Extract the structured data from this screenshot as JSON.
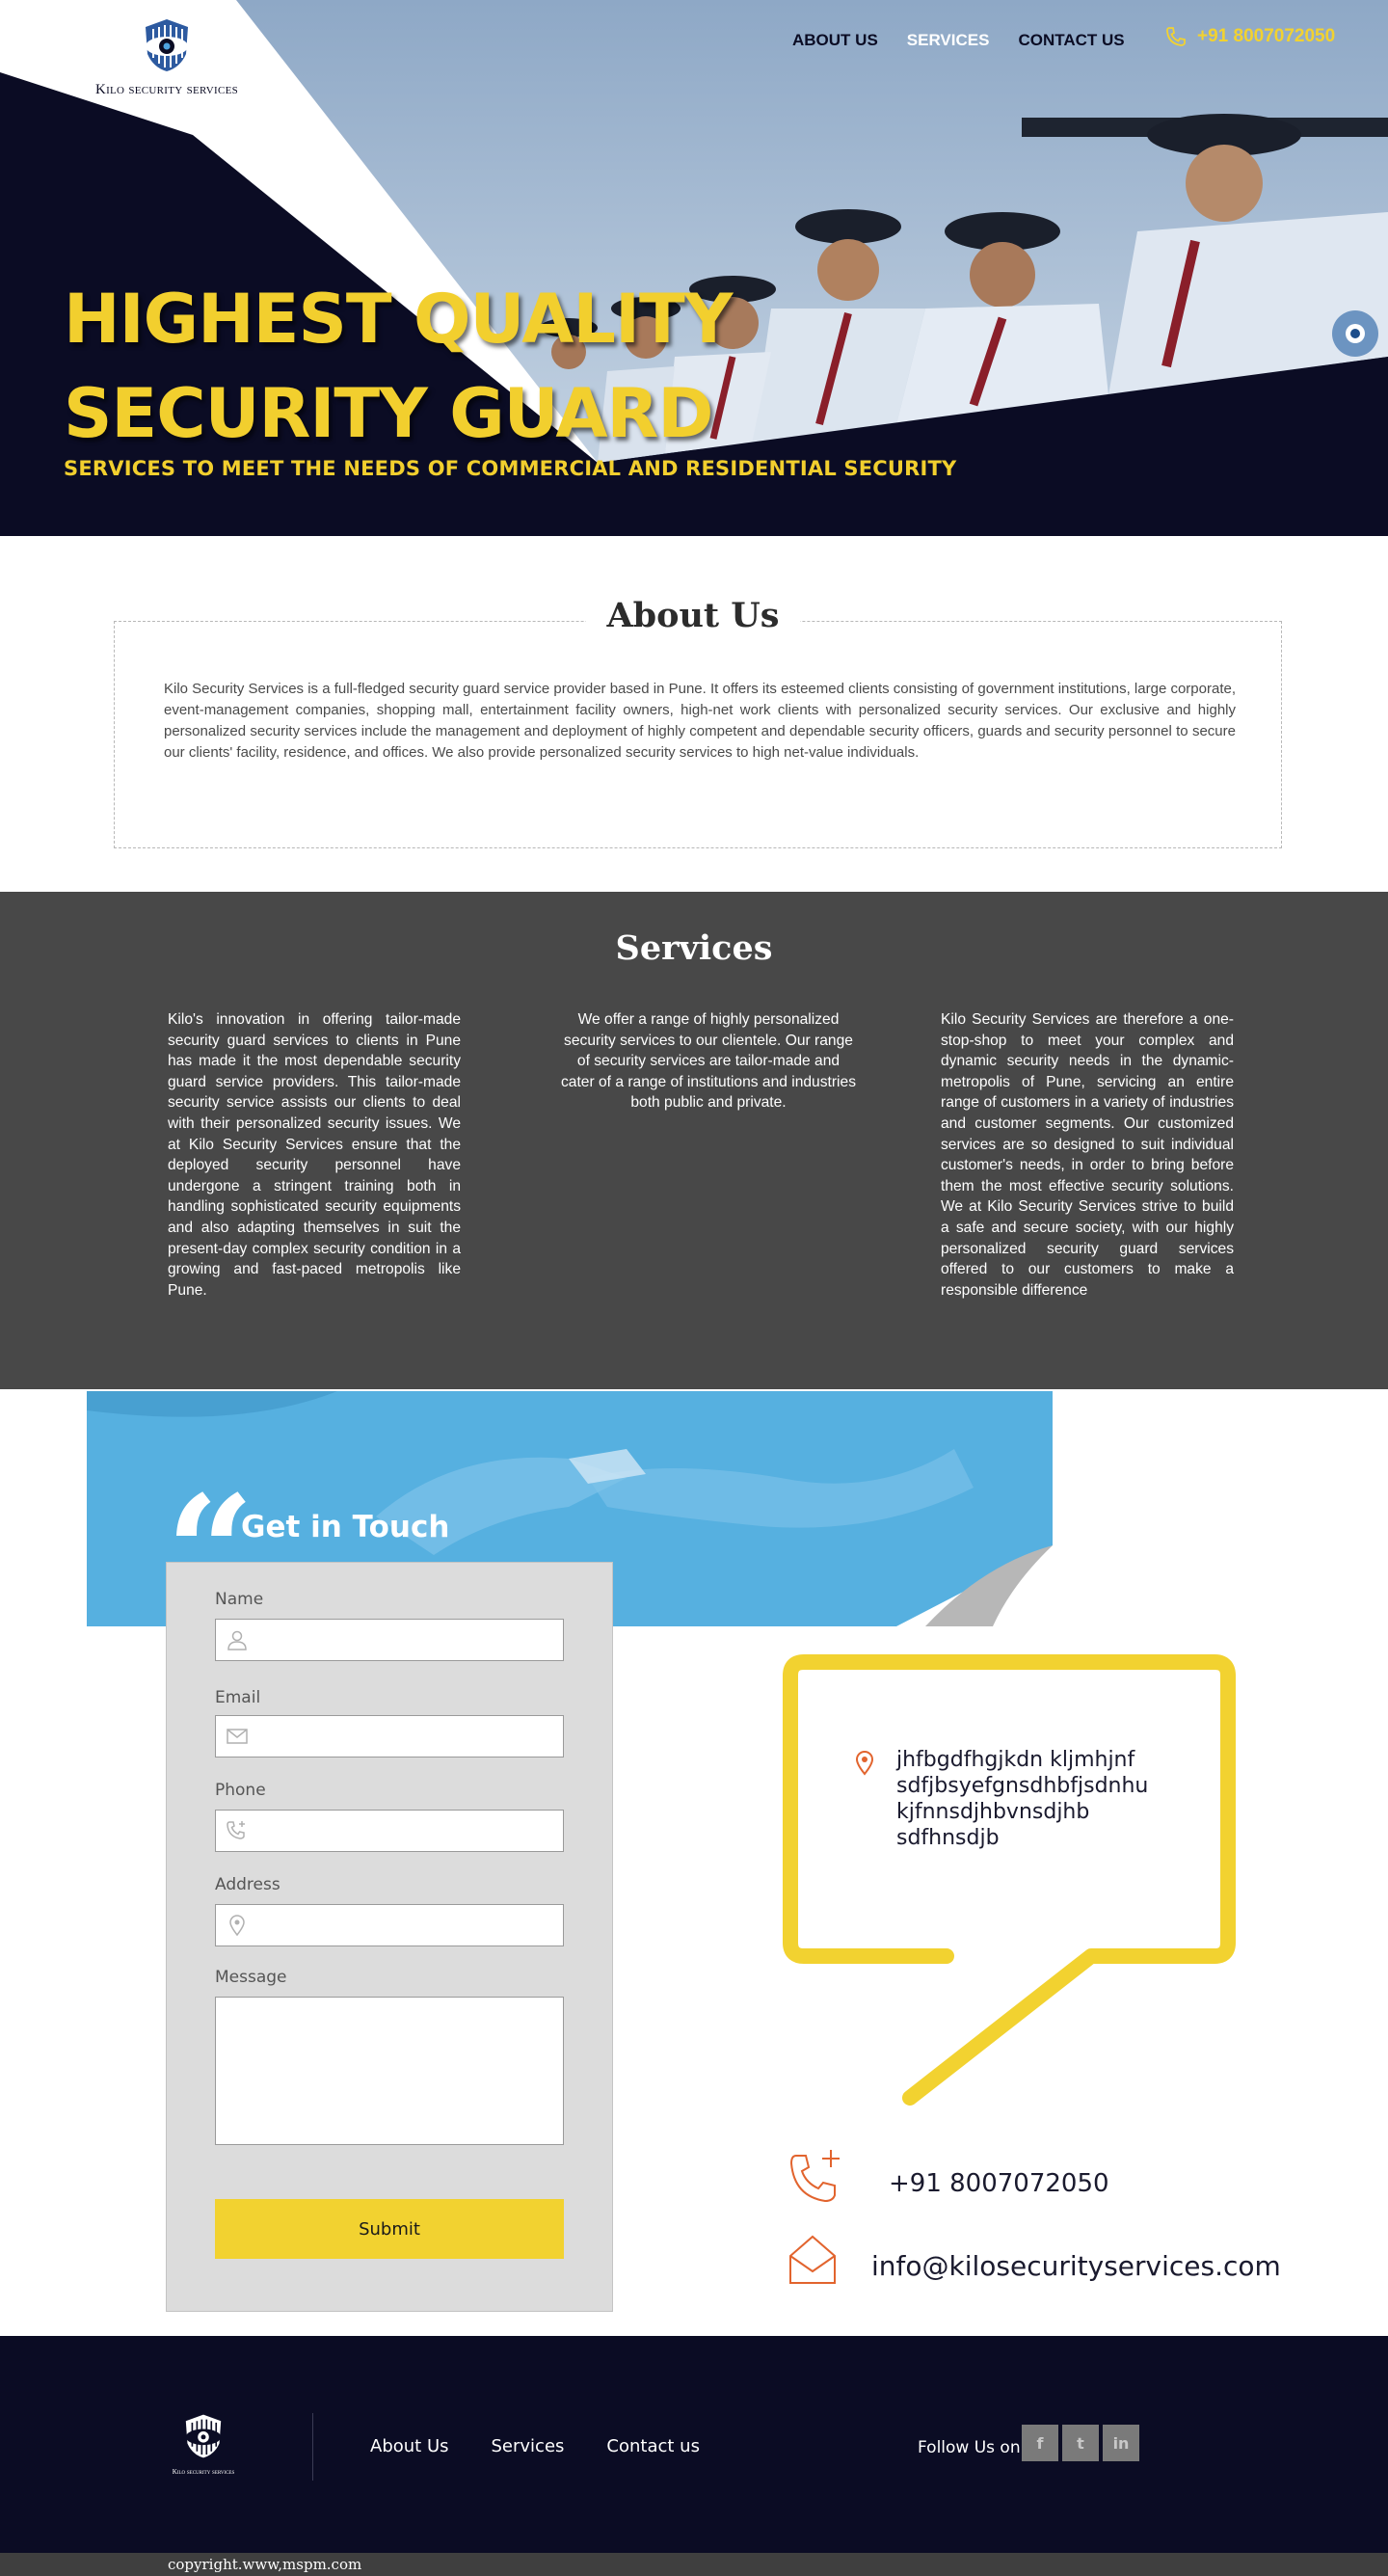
{
  "brand": {
    "name": "Kilo security services"
  },
  "nav": {
    "items": [
      {
        "label": "ABOUT US"
      },
      {
        "label": "SERVICES"
      },
      {
        "label": "CONTACT US"
      }
    ],
    "active_index": 1,
    "phone": "+91 8007072050"
  },
  "hero": {
    "title_line1": "HIGHEST QUALITY",
    "title_line2": "SECURITY GUARD",
    "subtitle": "SERVICES TO MEET THE NEEDS OF COMMERCIAL AND RESIDENTIAL SECURITY"
  },
  "about": {
    "title": "About Us",
    "text": "Kilo Security Services is a full-fledged security guard service provider based in Pune. It offers its esteemed clients consisting of government institutions, large corporate, event-management companies, shopping mall, entertainment facility owners, high-net work clients with personalized security services. Our exclusive and highly personalized security services include the management and deployment of highly competent and dependable security officers, guards and security personnel to secure our clients' facility, residence, and offices. We also provide personalized security services to high net-value individuals."
  },
  "services": {
    "title": "Services",
    "col1": "Kilo's innovation in offering tailor-made security guard services to clients in Pune has made it the most dependable security guard service providers. This tailor-made security service assists our clients to deal with their personalized security issues. We at Kilo Security Services ensure that the deployed security personnel have undergone a stringent training both in handling sophisticated security equipments and also adapting themselves in suit the present-day complex security condition in a growing and fast-paced metropolis like Pune.",
    "col2": "We offer a range of highly personalized security services to our clientele. Our range of security services are tailor-made and cater of a range of institutions and industries both public and private.",
    "col3": "Kilo Security Services are therefore a one-stop-shop to meet your complex and dynamic security needs in the dynamic-metropolis of Pune, servicing an entire range of customers in a variety of industries and customer segments. Our customized services are so designed to suit individual customer's needs, in order to bring before them the most effective security solutions. We at Kilo Security Services strive to build a safe and secure society, with our highly personalized security guard services offered to our customers to make a responsible difference"
  },
  "contact": {
    "title": "Get in Touch",
    "form": {
      "name_label": "Name",
      "email_label": "Email",
      "phone_label": "Phone",
      "address_label": "Address",
      "message_label": "Message",
      "submit_label": "Submit"
    },
    "address_lines": [
      "jhfbgdfhgjkdn kljmhjnf",
      "sdfjbsyefgnsdhbfjsdnhu",
      "kjfnnsdjhbvnsdjhb",
      "sdfhnsdjb"
    ],
    "phone": "+91 8007072050",
    "email": "info@kilosecurityservices.com"
  },
  "footer": {
    "brand": "Kilo security services",
    "links": [
      {
        "label": "About Us"
      },
      {
        "label": "Services"
      },
      {
        "label": "Contact us"
      }
    ],
    "follow_label": "Follow Us on",
    "social": [
      {
        "icon": "facebook-icon",
        "glyph": "f"
      },
      {
        "icon": "twitter-icon",
        "glyph": "t"
      },
      {
        "icon": "linkedin-icon",
        "glyph": "in"
      }
    ],
    "copyright": "copyright.www,mspm.com"
  },
  "colors": {
    "navy": "#0b0c24",
    "yellow": "#f2d230",
    "sky": "#8fa9c6",
    "banner_blue": "#56b0e0",
    "services_gray": "#484848",
    "accent_orange": "#e2642e"
  }
}
